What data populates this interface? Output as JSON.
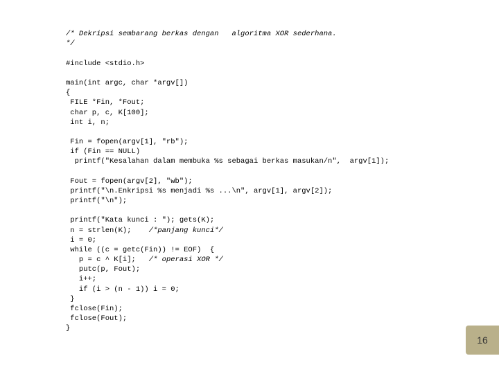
{
  "code": {
    "comment_open": "/* Dekripsi sembarang berkas dengan   algoritma XOR sederhana.",
    "comment_close": "*/",
    "include": "#include <stdio.h>",
    "main_sig": "main(int argc, char *argv[])",
    "brace_open": "{",
    "decl1": " FILE *Fin, *Fout;",
    "decl2": " char p, c, K[100];",
    "decl3": " int i, n;",
    "fin_open": " Fin = fopen(argv[1], \"rb\");",
    "fin_check": " if (Fin == NULL)",
    "fin_err": "  printf(\"Kesalahan dalam membuka %s sebagai berkas masukan/n\",  argv[1]);",
    "fout_open": " Fout = fopen(argv[2], \"wb\");",
    "msg1": " printf(\"\\n.Enkripsi %s menjadi %s ...\\n\", argv[1], argv[2]);",
    "msg2": " printf(\"\\n\");",
    "prompt": " printf(\"Kata kunci : \"); gets(K);",
    "nlen_pre": " n = strlen(K);    ",
    "nlen_comment": "/*panjang kunci*/",
    "i0": " i = 0;",
    "while": " while ((c = getc(Fin)) != EOF)  {",
    "xor_pre": "   p = c ^ K[i];   ",
    "xor_comment": "/* operasi XOR */",
    "putc": "   putc(p, Fout);",
    "ipp": "   i++;",
    "wrap": "   if (i > (n - 1)) i = 0;",
    "brace_inner": " }",
    "close1": " fclose(Fin);",
    "close2": " fclose(Fout);",
    "brace_end": "}"
  },
  "page_number": "16"
}
